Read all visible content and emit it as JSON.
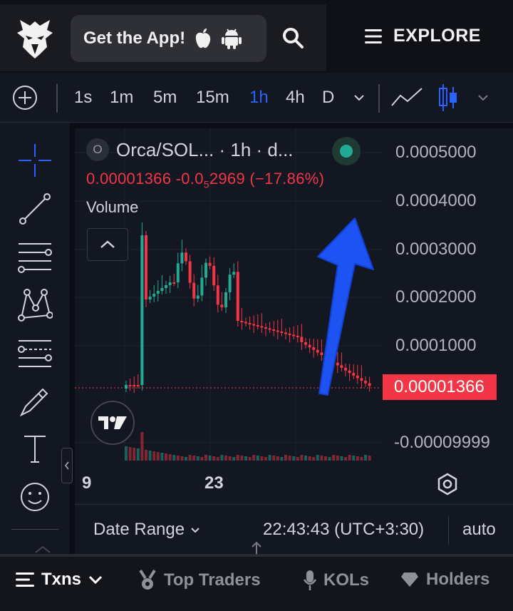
{
  "header": {
    "get_app_label": "Get the App!",
    "explore_label": "EXPLORE"
  },
  "toolbar": {
    "intervals": [
      "1s",
      "1m",
      "5m",
      "15m",
      "1h",
      "4h",
      "D"
    ],
    "active_interval": "1h"
  },
  "chart": {
    "symbol_icon_text": "O",
    "symbol_title": "Orca/SOL... · 1h · d...",
    "price_line": "0.00001366  -0.0",
    "price_sub": "5",
    "price_change": "2969 (−17.86%)",
    "volume_label": "Volume",
    "price_axis": [
      "0.0005000",
      "0.0004000",
      "0.0003000",
      "0.0002000",
      "0.0001000",
      "-0.00009999"
    ],
    "last_price_tag": "0.00001366",
    "time_axis": [
      "9",
      "23"
    ],
    "date_range_label": "Date Range",
    "clock": "22:43:43 (UTC+3:30)",
    "scale_mode": "auto",
    "colors": {
      "up": "#22ab94",
      "down": "#f23645",
      "accent": "#2962ff"
    }
  },
  "tabs": [
    {
      "label": "Txns",
      "icon": "list-icon"
    },
    {
      "label": "Top Traders",
      "icon": "medal-icon"
    },
    {
      "label": "KOLs",
      "icon": "microphone-icon"
    },
    {
      "label": "Holders",
      "icon": "diamond-icon"
    }
  ]
}
